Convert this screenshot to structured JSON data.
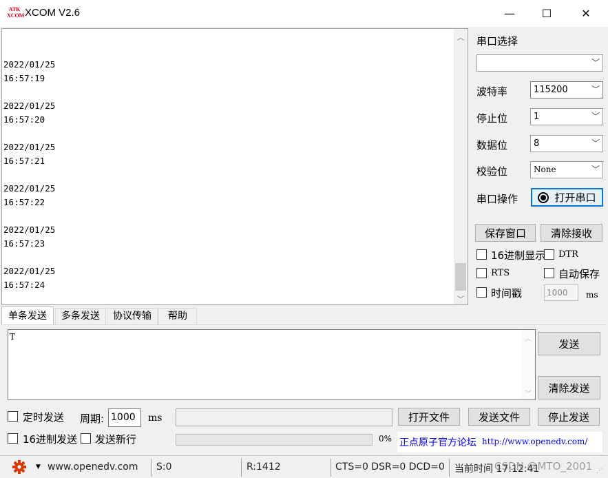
{
  "window": {
    "title": "XCOM V2.6",
    "logo_text_top": "ATK",
    "logo_text_bottom": "XCOM",
    "minimize": "—",
    "maximize": "☐",
    "close": "✕"
  },
  "receive": {
    "lines": "\n2022/01/25\n16:57:19\n\n2022/01/25\n16:57:20\n\n2022/01/25\n16:57:21\n\n2022/01/25\n16:57:22\n\n2022/01/25\n16:57:23\n\n2022/01/25\n16:57:24"
  },
  "settings": {
    "port_select_label": "串口选择",
    "port_value": "",
    "baud_label": "波特率",
    "baud_value": "115200",
    "stopbits_label": "停止位",
    "stopbits_value": "1",
    "databits_label": "数据位",
    "databits_value": "8",
    "parity_label": "校验位",
    "parity_value": "None",
    "port_op_label": "串口操作",
    "open_port_button": "打开串口",
    "save_window_button": "保存窗口",
    "clear_receive_button": "清除接收",
    "hex_display_label": "16进制显示",
    "dtr_label": "DTR",
    "rts_label": "RTS",
    "auto_save_label": "自动保存",
    "timestamp_label": "时间戳",
    "timestamp_interval": "1000",
    "ms_label": "ms"
  },
  "tabs": [
    {
      "label": "单条发送"
    },
    {
      "label": "多条发送"
    },
    {
      "label": "协议传输"
    },
    {
      "label": "帮助"
    }
  ],
  "send": {
    "text": "T",
    "send_button": "发送",
    "clear_send_button": "清除发送",
    "timed_send_label": "定时发送",
    "period_label": "周期:",
    "period_value": "1000",
    "period_unit": "ms",
    "file_path": "",
    "open_file_button": "打开文件",
    "send_file_button": "发送文件",
    "stop_send_button": "停止发送",
    "hex_send_label": "16进制发送",
    "send_newline_label": "发送新行",
    "progress_percent_text": "0%",
    "progress": 0,
    "forum_link_label": "正点原子官方论坛",
    "forum_url": "http://www.openedv.com/"
  },
  "status": {
    "site": "www.openedv.com",
    "sent": "S:0",
    "received": "R:1412",
    "lines": "CTS=0 DSR=0 DCD=0",
    "time": "当前时间 17:12:41",
    "watermark": "CSDN @MTO_2001"
  },
  "colors": {
    "accent_link": "#0000ff",
    "logo_red": "#d6001c",
    "gear_red": "#d83b01",
    "focus_blue": "#0078d7"
  }
}
